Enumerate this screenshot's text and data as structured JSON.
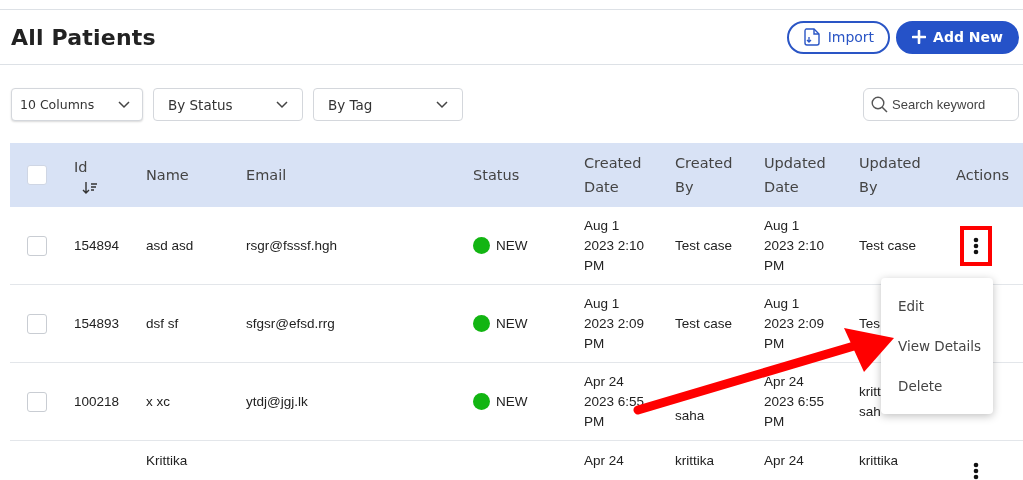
{
  "page": {
    "title": "All Patients"
  },
  "buttons": [
    {
      "kind": "outline",
      "label": "Import"
    },
    {
      "kind": "primary",
      "label": "Add New"
    }
  ],
  "filters": [
    {
      "label": "10 Columns"
    },
    {
      "label": "By Status"
    },
    {
      "label": "By Tag"
    }
  ],
  "search": {
    "placeholder": "Search keyword"
  },
  "table": {
    "select_all": {
      "checked": false
    },
    "columns": [
      {
        "lines": [
          "Id"
        ],
        "sorted": true
      },
      {
        "lines": [
          "Name"
        ],
        "sorted": false
      },
      {
        "lines": [
          "Email"
        ],
        "sorted": false
      },
      {
        "lines": [
          "Status"
        ],
        "sorted": false
      },
      {
        "lines": [
          "Created",
          "Date"
        ],
        "sorted": false
      },
      {
        "lines": [
          "Created",
          "By"
        ],
        "sorted": false
      },
      {
        "lines": [
          "Updated",
          "Date"
        ],
        "sorted": false
      },
      {
        "lines": [
          "Updated",
          "By"
        ],
        "sorted": false
      },
      {
        "lines": [
          "Actions"
        ],
        "sorted": false
      }
    ],
    "rows": [
      {
        "checked": false,
        "id": "154894",
        "name": [
          "asd asd"
        ],
        "email": "rsgr@fsssf.hgh",
        "status": "NEW",
        "color": "#12b512",
        "created_date": [
          "Aug 1",
          "2023 2:10",
          "PM"
        ],
        "created_by": [
          "Test case"
        ],
        "updated_date": [
          "Aug 1",
          "2023 2:10",
          "PM"
        ],
        "updated_by": [
          "Test case"
        ],
        "menu_open": true
      },
      {
        "checked": false,
        "id": "154893",
        "name": [
          "dsf sf"
        ],
        "email": "sfgsr@efsd.rrg",
        "status": "NEW",
        "color": "#12b512",
        "created_date": [
          "Aug 1",
          "2023 2:09",
          "PM"
        ],
        "created_by": [
          "Test case"
        ],
        "updated_date": [
          "Aug 1",
          "2023 2:09",
          "PM"
        ],
        "updated_by": [
          "Tes"
        ]
      },
      {
        "checked": false,
        "id": "100218",
        "name": [
          "x xc"
        ],
        "email": "ytdj@jgj.lk",
        "status": "NEW",
        "color": "#12b512",
        "created_date": [
          "Apr 24",
          "2023 6:55",
          "PM"
        ],
        "created_by": [
          "saha"
        ],
        "updated_date": [
          "Apr 24",
          "2023 6:55",
          "PM"
        ],
        "updated_by": [
          "kritt",
          "sah"
        ]
      },
      {
        "name": [
          "Krittika"
        ],
        "created_date": [
          "Apr 24"
        ],
        "created_by": [
          "krittika"
        ],
        "updated_date": [
          "Apr 24"
        ],
        "updated_by": [
          "krittika"
        ],
        "menu_open": false
      }
    ]
  },
  "row_menu": {
    "items": [
      "Edit",
      "View Details",
      "Delete"
    ]
  }
}
